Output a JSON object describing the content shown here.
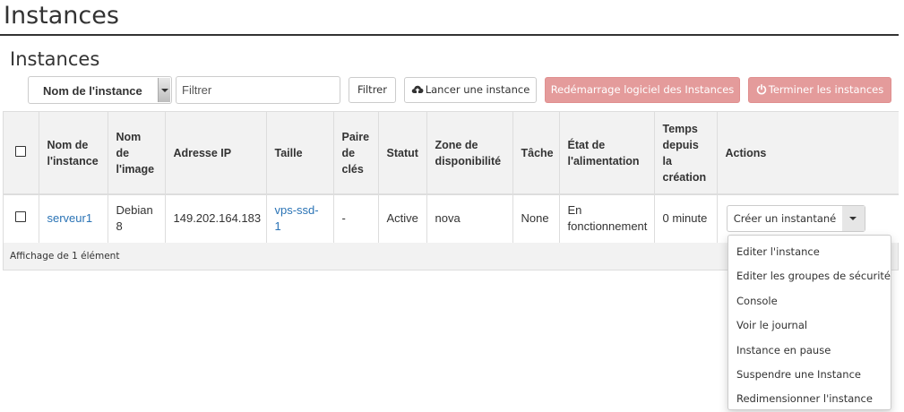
{
  "page": {
    "title": "Instances"
  },
  "section": {
    "title": "Instances"
  },
  "toolbar": {
    "filter_field": "Nom de l'instance",
    "filter_placeholder": "Filtrer",
    "filter_button": "Filtrer",
    "launch_button": "Lancer une instance",
    "soft_reboot_button": "Redémarrage logiciel des Instances",
    "terminate_button": "Terminer les instances"
  },
  "table": {
    "headers": [
      "Nom de l'instance",
      "Nom de l'image",
      "Adresse IP",
      "Taille",
      "Paire de clés",
      "Statut",
      "Zone de disponibilité",
      "Tâche",
      "État de l'alimentation",
      "Temps depuis la création",
      "Actions"
    ],
    "rows": [
      {
        "name": "serveur1",
        "image": "Debian 8",
        "ip": "149.202.164.183",
        "size": "vps-ssd-1",
        "keypair": "-",
        "status": "Active",
        "zone": "nova",
        "task": "None",
        "power": "En fonctionnement",
        "age": "0 minute",
        "action": "Créer un instantané"
      }
    ],
    "footer": "Affichage de 1 élément"
  },
  "dropdown": {
    "items": [
      "Editer l'instance",
      "Editer les groupes de sécurité",
      "Console",
      "Voir le journal",
      "Instance en pause",
      "Suspendre une Instance",
      "Redimensionner l'instance"
    ]
  },
  "colors": {
    "link": "#2a73b5",
    "danger_disabled": "#e49b9b",
    "header_bg": "#f2f2f2"
  }
}
